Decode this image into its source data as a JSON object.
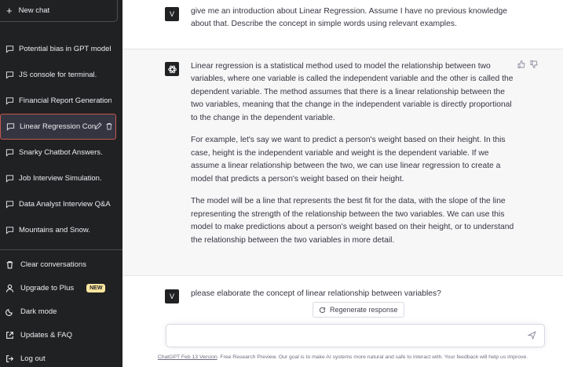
{
  "sidebar": {
    "new_chat": "New chat",
    "chats": [
      {
        "label": "Potential bias in GPT models"
      },
      {
        "label": "JS console for terminal."
      },
      {
        "label": "Financial Report Generation."
      },
      {
        "label": "Linear Regression Con"
      },
      {
        "label": "Snarky Chatbot Answers."
      },
      {
        "label": "Job Interview Simulation."
      },
      {
        "label": "Data Analyst Interview Q&A"
      },
      {
        "label": "Mountains and Snow."
      }
    ],
    "bottom": {
      "clear": "Clear conversations",
      "upgrade": "Upgrade to Plus",
      "upgrade_badge": "NEW",
      "dark": "Dark mode",
      "updates": "Updates & FAQ",
      "logout": "Log out"
    }
  },
  "conversation": {
    "user_avatar": "V",
    "q1": "give me an introduction about Linear Regression. Assume I have no previous knowledge about that. Describe the concept in simple words using relevant examples.",
    "a1": [
      "Linear regression is a statistical method used to model the relationship between two variables, where one variable is called the independent variable and the other is called the dependent variable. The method assumes that there is a linear relationship between the two variables, meaning that the change in the independent variable is directly proportional to the change in the dependent variable.",
      "For example, let's say we want to predict a person's weight based on their height. In this case, height is the independent variable and weight is the dependent variable. If we assume a linear relationship between the two, we can use linear regression to create a model that predicts a person's weight based on their height.",
      "The model will be a line that represents the best fit for the data, with the slope of the line representing the strength of the relationship between the two variables. We can use this model to make predictions about a person's weight based on their height, or to understand the relationship between the two variables in more detail."
    ],
    "q2": "please elaborate the concept of linear relationship between variables?"
  },
  "composer": {
    "regenerate": "Regenerate response",
    "footer_link": "ChatGPT Feb 13 Version",
    "footer_text": ". Free Research Preview. Our goal is to make AI systems more natural and safe to interact with. Your feedback will help us improve."
  },
  "colors": {
    "sidebar_bg": "#202123",
    "active_border": "#c9574d",
    "bot_row_bg": "#f7f7f8",
    "badge_bg": "#fae69e"
  }
}
